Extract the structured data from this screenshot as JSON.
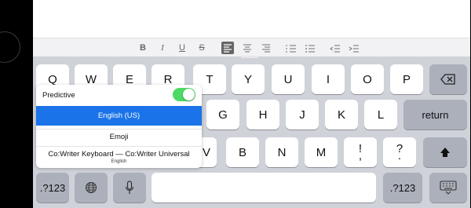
{
  "format_toolbar": {
    "bold": "B",
    "italic": "I",
    "underline": "U",
    "strikethrough": "S",
    "icons": [
      "align-left-icon",
      "align-center-icon",
      "align-right-icon",
      "numbered-list-icon",
      "bulleted-list-icon",
      "indent-decrease-icon",
      "indent-increase-icon"
    ],
    "selected_color": "#666666"
  },
  "keyboard": {
    "row1": [
      "Q",
      "W",
      "E",
      "R",
      "T",
      "Y",
      "U",
      "I",
      "O",
      "P"
    ],
    "row2": [
      "G",
      "H",
      "J",
      "K",
      "L"
    ],
    "return_label": "return",
    "row3": [
      "V",
      "B",
      "N",
      "M"
    ],
    "punct1": {
      "top": "!",
      "bottom": ","
    },
    "punct2": {
      "top": "?",
      "bottom": "."
    },
    "numbers_left": ".?123",
    "numbers_right": ".?123",
    "icons": [
      "backspace-icon",
      "shift-icon",
      "globe-icon",
      "microphone-icon",
      "keyboard-hide-icon"
    ]
  },
  "language_menu": {
    "predictive_label": "Predictive",
    "predictive_on": true,
    "toggle_color": "#4cd964",
    "options": [
      {
        "label": "English (US)",
        "selected": true
      },
      {
        "label": "Emoji",
        "selected": false
      },
      {
        "label": "Co:Writer Keyboard — Co:Writer Universal",
        "sublabel": "English",
        "selected": false
      }
    ],
    "selected_color": "#1a73e8"
  }
}
